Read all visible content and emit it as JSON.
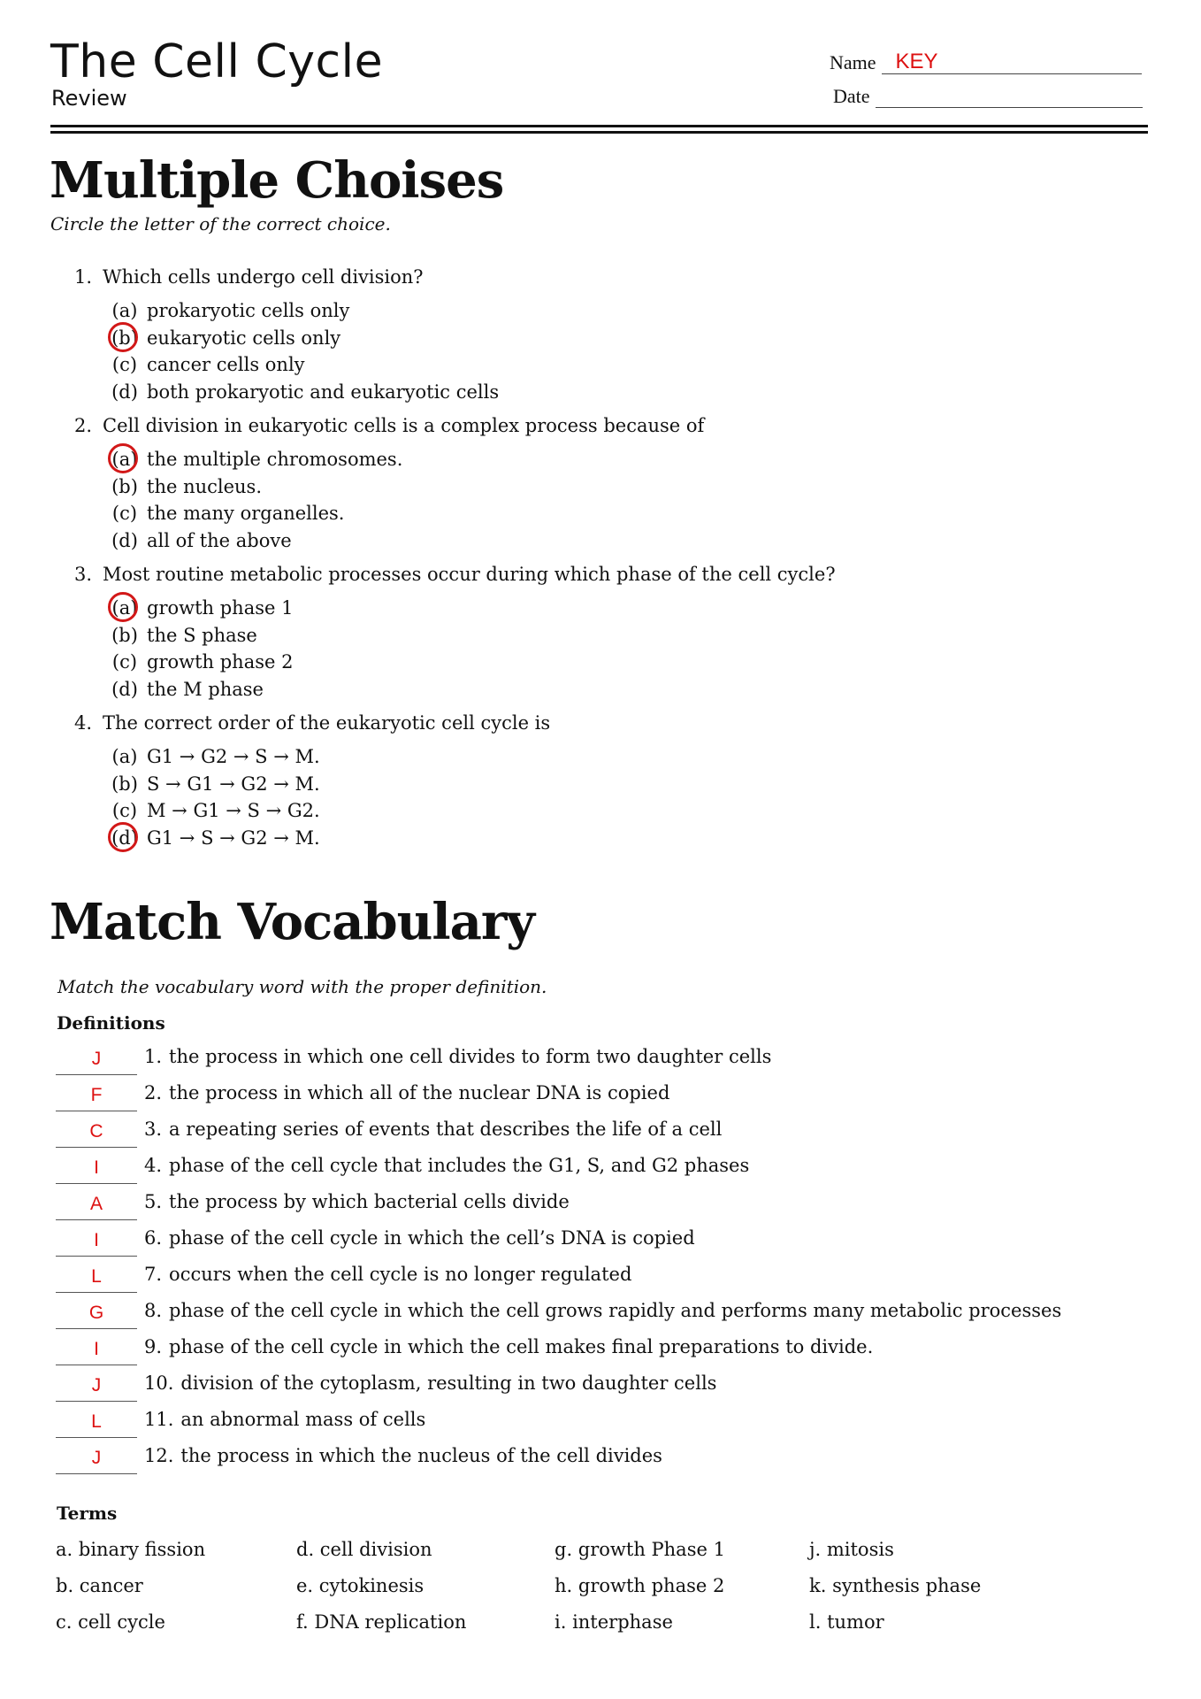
{
  "header": {
    "title": "The Cell Cycle",
    "subtitle": "Review",
    "name_label": "Name",
    "name_value": "KEY",
    "date_label": "Date",
    "date_value": ""
  },
  "multiple_choice": {
    "heading": "Multiple Choises",
    "instruction": "Circle the letter of the correct choice.",
    "questions": [
      {
        "number": "1.",
        "text": "Which cells undergo cell division?",
        "answer": "b",
        "options": [
          {
            "letter": "(a)",
            "text": "prokaryotic cells only"
          },
          {
            "letter": "(b)",
            "text": "eukaryotic cells only"
          },
          {
            "letter": "(c)",
            "text": "cancer cells only"
          },
          {
            "letter": "(d)",
            "text": "both prokaryotic and eukaryotic cells"
          }
        ]
      },
      {
        "number": "2.",
        "text": "Cell division in eukaryotic cells is a complex process because of",
        "answer": "a",
        "options": [
          {
            "letter": "(a)",
            "text": "the multiple chromosomes."
          },
          {
            "letter": "(b)",
            "text": "the nucleus."
          },
          {
            "letter": "(c)",
            "text": "the many organelles."
          },
          {
            "letter": "(d)",
            "text": "all of the above"
          }
        ]
      },
      {
        "number": "3.",
        "text": "Most routine metabolic processes occur during which phase of the cell cycle?",
        "answer": "a",
        "options": [
          {
            "letter": "(a)",
            "text": "growth phase 1"
          },
          {
            "letter": "(b)",
            "text": "the S phase"
          },
          {
            "letter": "(c)",
            "text": "growth phase 2"
          },
          {
            "letter": "(d)",
            "text": "the M phase"
          }
        ]
      },
      {
        "number": "4.",
        "text": "The correct order of the eukaryotic cell cycle is",
        "answer": "d",
        "options": [
          {
            "letter": "(a)",
            "text": "G1 → G2 → S → M."
          },
          {
            "letter": "(b)",
            "text": "S → G1 → G2 → M."
          },
          {
            "letter": "(c)",
            "text": "M → G1 → S → G2."
          },
          {
            "letter": "(d)",
            "text": "G1 → S → G2 → M."
          }
        ]
      }
    ]
  },
  "vocabulary": {
    "heading": "Match Vocabulary",
    "instruction": "Match the vocabulary word with the proper definition.",
    "definitions_label": "Definitions",
    "definitions": [
      {
        "answer": "J",
        "number": "1.",
        "text": "the process in which one cell divides to form two daughter cells"
      },
      {
        "answer": "F",
        "number": "2.",
        "text": "the process in which all of the nuclear DNA is copied"
      },
      {
        "answer": "C",
        "number": "3.",
        "text": "a repeating series of events that describes the life of a cell"
      },
      {
        "answer": "I",
        "number": "4.",
        "text": "phase of the cell cycle that includes the G1, S, and G2 phases"
      },
      {
        "answer": "A",
        "number": "5.",
        "text": "the process by which bacterial cells divide"
      },
      {
        "answer": "I",
        "number": "6.",
        "text": "phase of the cell cycle in which the cell’s DNA is copied"
      },
      {
        "answer": "L",
        "number": "7.",
        "text": "occurs when the cell cycle is no longer regulated"
      },
      {
        "answer": "G",
        "number": "8.",
        "text": "phase of the cell cycle in which the cell grows rapidly and performs many metabolic processes"
      },
      {
        "answer": "I",
        "number": "9.",
        "text": "phase of the cell cycle in which the cell makes final preparations to divide."
      },
      {
        "answer": "J",
        "number": "10.",
        "text": "division of the cytoplasm, resulting in two daughter cells"
      },
      {
        "answer": "L",
        "number": "11.",
        "text": "an abnormal mass of cells"
      },
      {
        "answer": "J",
        "number": "12.",
        "text": "the process in which the nucleus of the cell divides"
      }
    ],
    "terms_label": "Terms",
    "terms": [
      [
        "a. binary fission",
        "d. cell division",
        "g. growth Phase 1",
        "j. mitosis"
      ],
      [
        "b. cancer",
        "e. cytokinesis",
        "h. growth phase 2",
        "k. synthesis phase"
      ],
      [
        "c. cell cycle",
        "f. DNA replication",
        "i. interphase",
        "l. tumor"
      ]
    ]
  },
  "colors": {
    "answer_red": "#dd1111",
    "circle_red": "#d21818",
    "text": "#111111"
  }
}
